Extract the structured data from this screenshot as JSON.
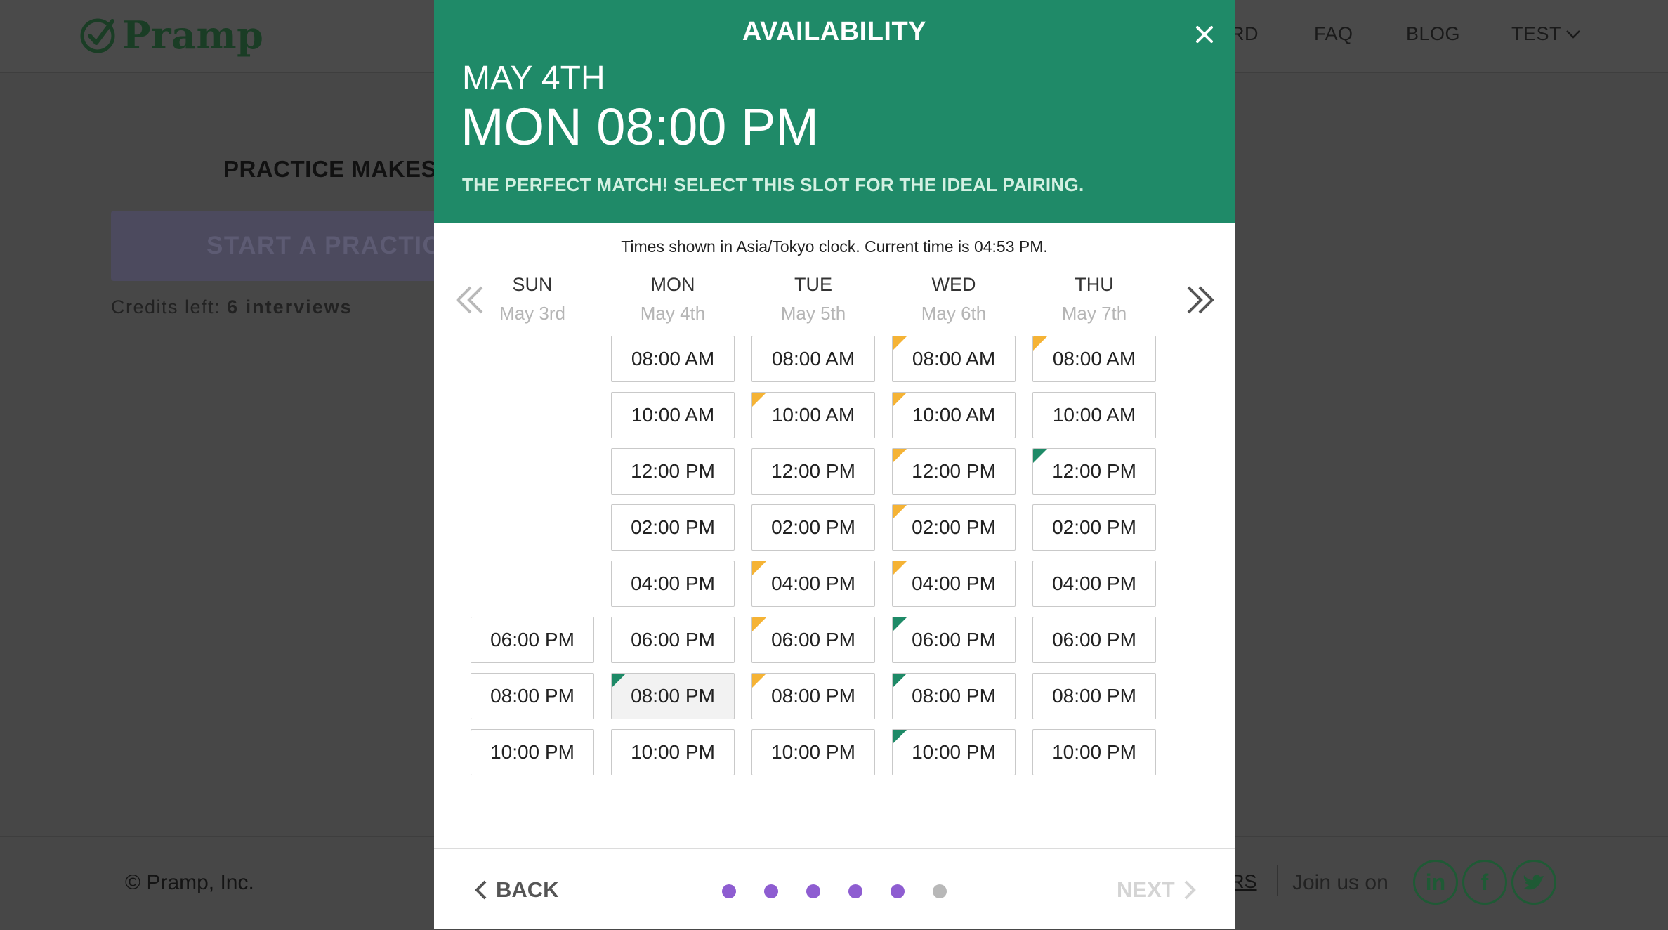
{
  "brand": {
    "name": "Pramp"
  },
  "nav": {
    "links": [
      "RD",
      "FAQ",
      "BLOG"
    ],
    "user_menu": "TEST"
  },
  "hero": {
    "title": "PRACTICE MAKES",
    "button": "START A PRACTIC",
    "credits_label": "Credits left:",
    "credits_value": "6 interviews"
  },
  "footer": {
    "copyright": "© Pramp, Inc.",
    "link": "RS",
    "join": "Join us on",
    "social_icons": [
      "linkedin-icon",
      "facebook-icon",
      "twitter-icon"
    ]
  },
  "modal": {
    "title": "AVAILABILITY",
    "selected_date": "MAY 4TH",
    "selected_time": "MON 08:00 PM",
    "message": "THE PERFECT MATCH! SELECT THIS SLOT FOR THE IDEAL PAIRING.",
    "timezone_note": "Times shown in Asia/Tokyo clock. Current time is 04:53 PM.",
    "back_label": "BACK",
    "next_label": "NEXT",
    "colors": {
      "header": "#1f8a68",
      "flag_good": "#f5b335",
      "flag_perfect": "#1e8a67",
      "dot_active": "#8e5dd1",
      "dot_inactive": "#b8b8b8"
    },
    "progress_dots": [
      true,
      true,
      true,
      true,
      true,
      false
    ],
    "days": [
      {
        "name": "SUN",
        "date": "May 3rd",
        "slots": [
          null,
          null,
          null,
          null,
          null,
          {
            "time": "06:00 PM",
            "flag": null
          },
          {
            "time": "08:00 PM",
            "flag": null
          },
          {
            "time": "10:00 PM",
            "flag": null
          }
        ]
      },
      {
        "name": "MON",
        "date": "May 4th",
        "slots": [
          {
            "time": "08:00 AM",
            "flag": null
          },
          {
            "time": "10:00 AM",
            "flag": null
          },
          {
            "time": "12:00 PM",
            "flag": null
          },
          {
            "time": "02:00 PM",
            "flag": null
          },
          {
            "time": "04:00 PM",
            "flag": null
          },
          {
            "time": "06:00 PM",
            "flag": null
          },
          {
            "time": "08:00 PM",
            "flag": "perfect",
            "selected": true
          },
          {
            "time": "10:00 PM",
            "flag": null
          }
        ]
      },
      {
        "name": "TUE",
        "date": "May 5th",
        "slots": [
          {
            "time": "08:00 AM",
            "flag": null
          },
          {
            "time": "10:00 AM",
            "flag": "good"
          },
          {
            "time": "12:00 PM",
            "flag": null
          },
          {
            "time": "02:00 PM",
            "flag": null
          },
          {
            "time": "04:00 PM",
            "flag": "good"
          },
          {
            "time": "06:00 PM",
            "flag": "good"
          },
          {
            "time": "08:00 PM",
            "flag": "good"
          },
          {
            "time": "10:00 PM",
            "flag": null
          }
        ]
      },
      {
        "name": "WED",
        "date": "May 6th",
        "slots": [
          {
            "time": "08:00 AM",
            "flag": "good"
          },
          {
            "time": "10:00 AM",
            "flag": "good"
          },
          {
            "time": "12:00 PM",
            "flag": "good"
          },
          {
            "time": "02:00 PM",
            "flag": "good"
          },
          {
            "time": "04:00 PM",
            "flag": "good"
          },
          {
            "time": "06:00 PM",
            "flag": "perfect"
          },
          {
            "time": "08:00 PM",
            "flag": "perfect"
          },
          {
            "time": "10:00 PM",
            "flag": "perfect"
          }
        ]
      },
      {
        "name": "THU",
        "date": "May 7th",
        "slots": [
          {
            "time": "08:00 AM",
            "flag": "good"
          },
          {
            "time": "10:00 AM",
            "flag": null
          },
          {
            "time": "12:00 PM",
            "flag": "perfect"
          },
          {
            "time": "02:00 PM",
            "flag": null
          },
          {
            "time": "04:00 PM",
            "flag": null
          },
          {
            "time": "06:00 PM",
            "flag": null
          },
          {
            "time": "08:00 PM",
            "flag": null
          },
          {
            "time": "10:00 PM",
            "flag": null
          }
        ]
      }
    ]
  }
}
